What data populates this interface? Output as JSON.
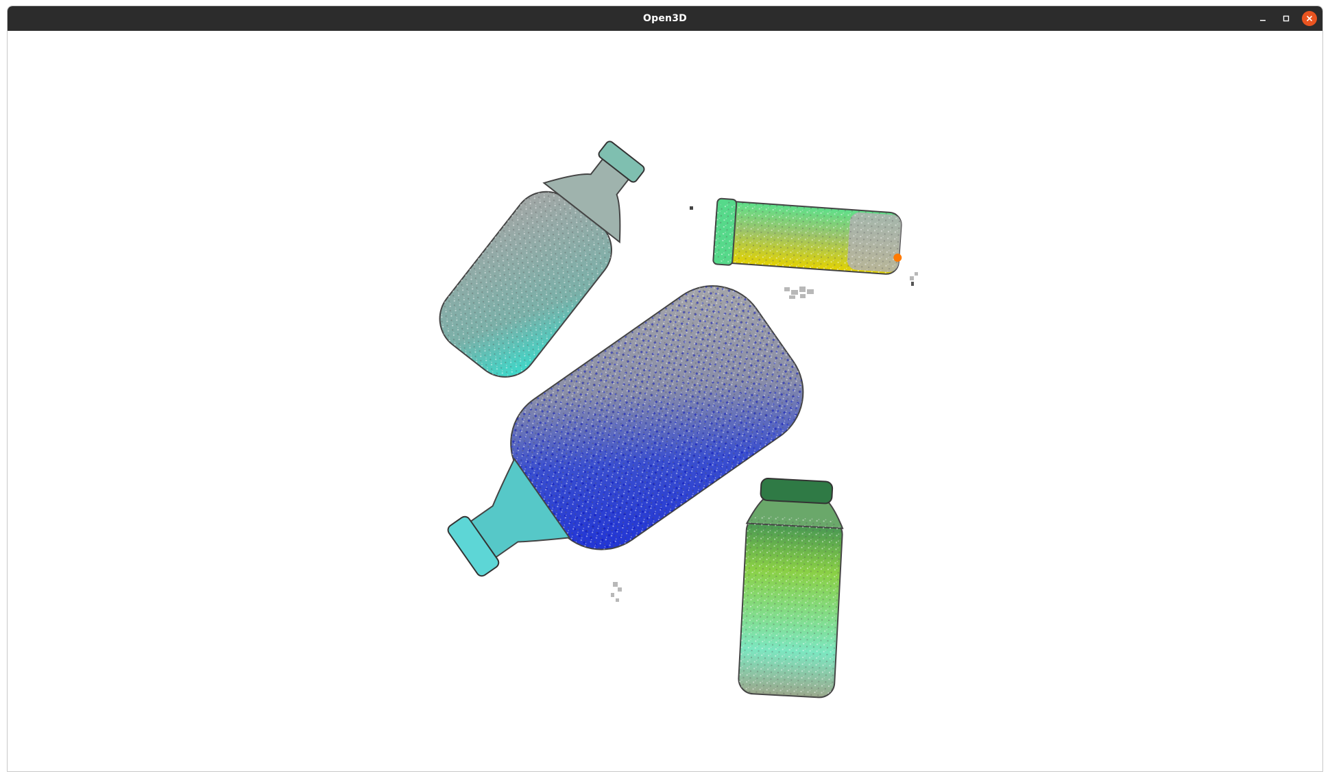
{
  "window": {
    "title": "Open3D",
    "controls": {
      "minimize": "minimize-icon",
      "maximize": "maximize-icon",
      "close": "close-icon"
    },
    "close_color": "#e95420",
    "titlebar_color": "#2c2c2c"
  },
  "viewport": {
    "background": "#ffffff",
    "objects": [
      "bottle",
      "bottle",
      "bottle",
      "bottle"
    ]
  }
}
